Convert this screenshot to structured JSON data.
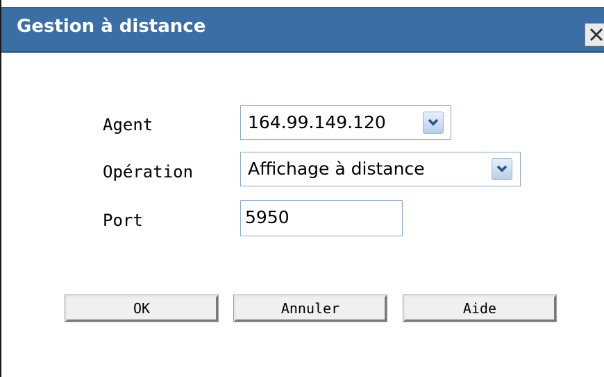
{
  "dialog": {
    "title": "Gestion à distance",
    "close_glyph": "✕"
  },
  "form": {
    "agent": {
      "label": "Agent",
      "value": "164.99.149.120"
    },
    "operation": {
      "label": "Opération",
      "value": "Affichage à distance"
    },
    "port": {
      "label": "Port",
      "value": "5950"
    }
  },
  "buttons": {
    "ok": "OK",
    "cancel": "Annuler",
    "help": "Aide"
  },
  "colors": {
    "titlebar": "#3c6ea6",
    "title_text": "#ffffff"
  },
  "icons": {
    "close": "close-icon",
    "dropdown": "chevron-down-icon"
  }
}
